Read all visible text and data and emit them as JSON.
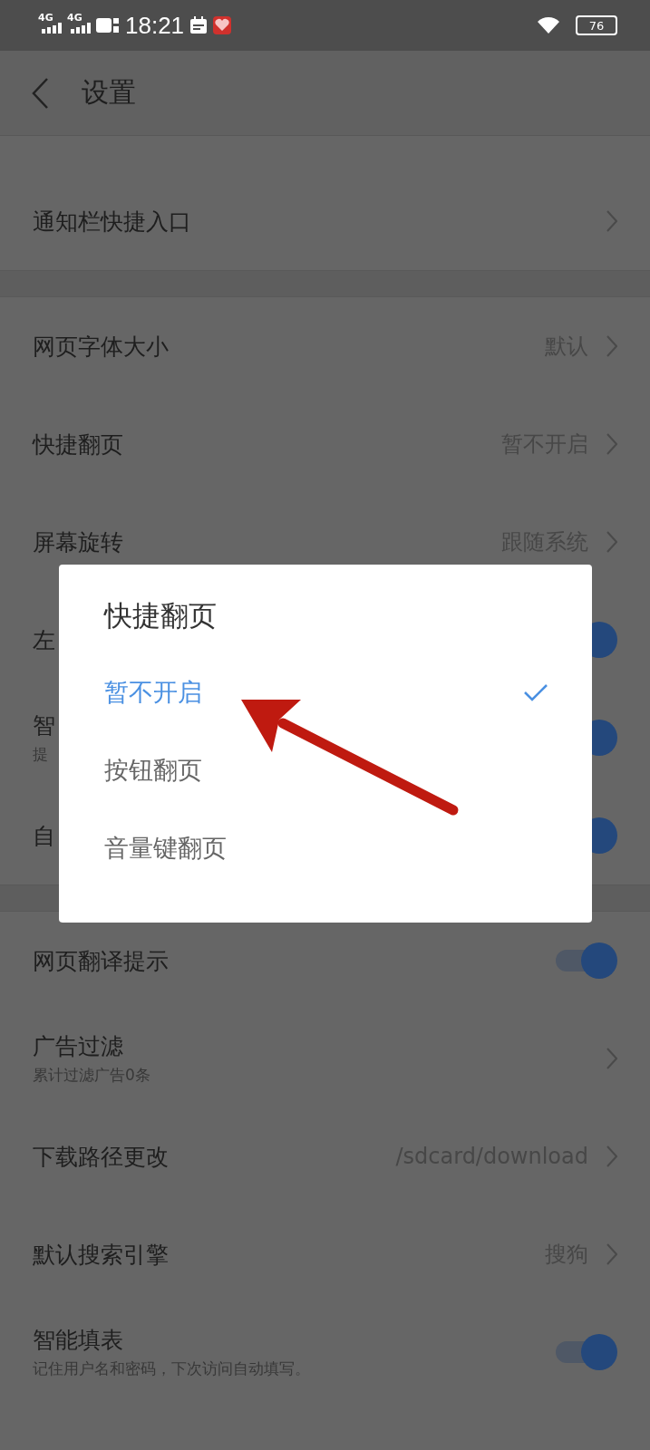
{
  "status_bar": {
    "networks": [
      "4G",
      "4G"
    ],
    "time": "18:21",
    "battery": "76"
  },
  "header": {
    "title": "设置"
  },
  "sections": [
    {
      "rows": [
        {
          "kind": "link",
          "label": "通知栏快捷入口"
        }
      ]
    },
    {
      "rows": [
        {
          "kind": "link",
          "label": "网页字体大小",
          "value": "默认"
        },
        {
          "kind": "link",
          "label": "快捷翻页",
          "value": "暂不开启"
        },
        {
          "kind": "link",
          "label": "屏幕旋转",
          "value": "跟随系统"
        },
        {
          "kind": "toggle",
          "label": "左",
          "on": true
        },
        {
          "kind": "toggle",
          "label": "智",
          "subtitle": "提",
          "on": true
        },
        {
          "kind": "toggle",
          "label": "自",
          "on": true
        }
      ]
    },
    {
      "rows": [
        {
          "kind": "toggle",
          "label": "网页翻译提示",
          "on": true
        },
        {
          "kind": "link",
          "label": "广告过滤",
          "subtitle": "累计过滤广告0条"
        },
        {
          "kind": "link",
          "label": "下载路径更改",
          "value": "/sdcard/download"
        },
        {
          "kind": "link",
          "label": "默认搜索引擎",
          "value": "搜狗"
        },
        {
          "kind": "toggle",
          "label": "智能填表",
          "subtitle": "记住用户名和密码，下次访问自动填写。",
          "on": true
        }
      ]
    }
  ],
  "dialog": {
    "title": "快捷翻页",
    "options": [
      {
        "label": "暂不开启",
        "selected": true
      },
      {
        "label": "按钮翻页",
        "selected": false
      },
      {
        "label": "音量键翻页",
        "selected": false
      }
    ]
  }
}
